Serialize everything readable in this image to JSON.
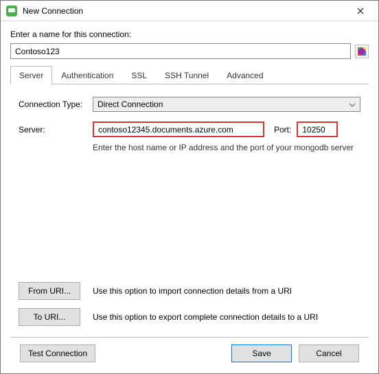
{
  "window": {
    "title": "New Connection"
  },
  "prompt": "Enter a name for this connection:",
  "connection_name": "Contoso123",
  "tabs": {
    "server": "Server",
    "authentication": "Authentication",
    "ssl": "SSL",
    "ssh_tunnel": "SSH Tunnel",
    "advanced": "Advanced"
  },
  "conn_type": {
    "label": "Connection Type:",
    "value": "Direct Connection"
  },
  "server": {
    "label": "Server:",
    "host": "contoso12345.documents.azure.com",
    "port_label": "Port:",
    "port": "10250",
    "hint": "Enter the host name or IP address and the port of your mongodb server"
  },
  "uri": {
    "from_label": "From URI...",
    "from_desc": "Use this option to import connection details from a URI",
    "to_label": "To URI...",
    "to_desc": "Use this option to export complete connection details to a URI"
  },
  "footer": {
    "test": "Test Connection",
    "save": "Save",
    "cancel": "Cancel"
  }
}
